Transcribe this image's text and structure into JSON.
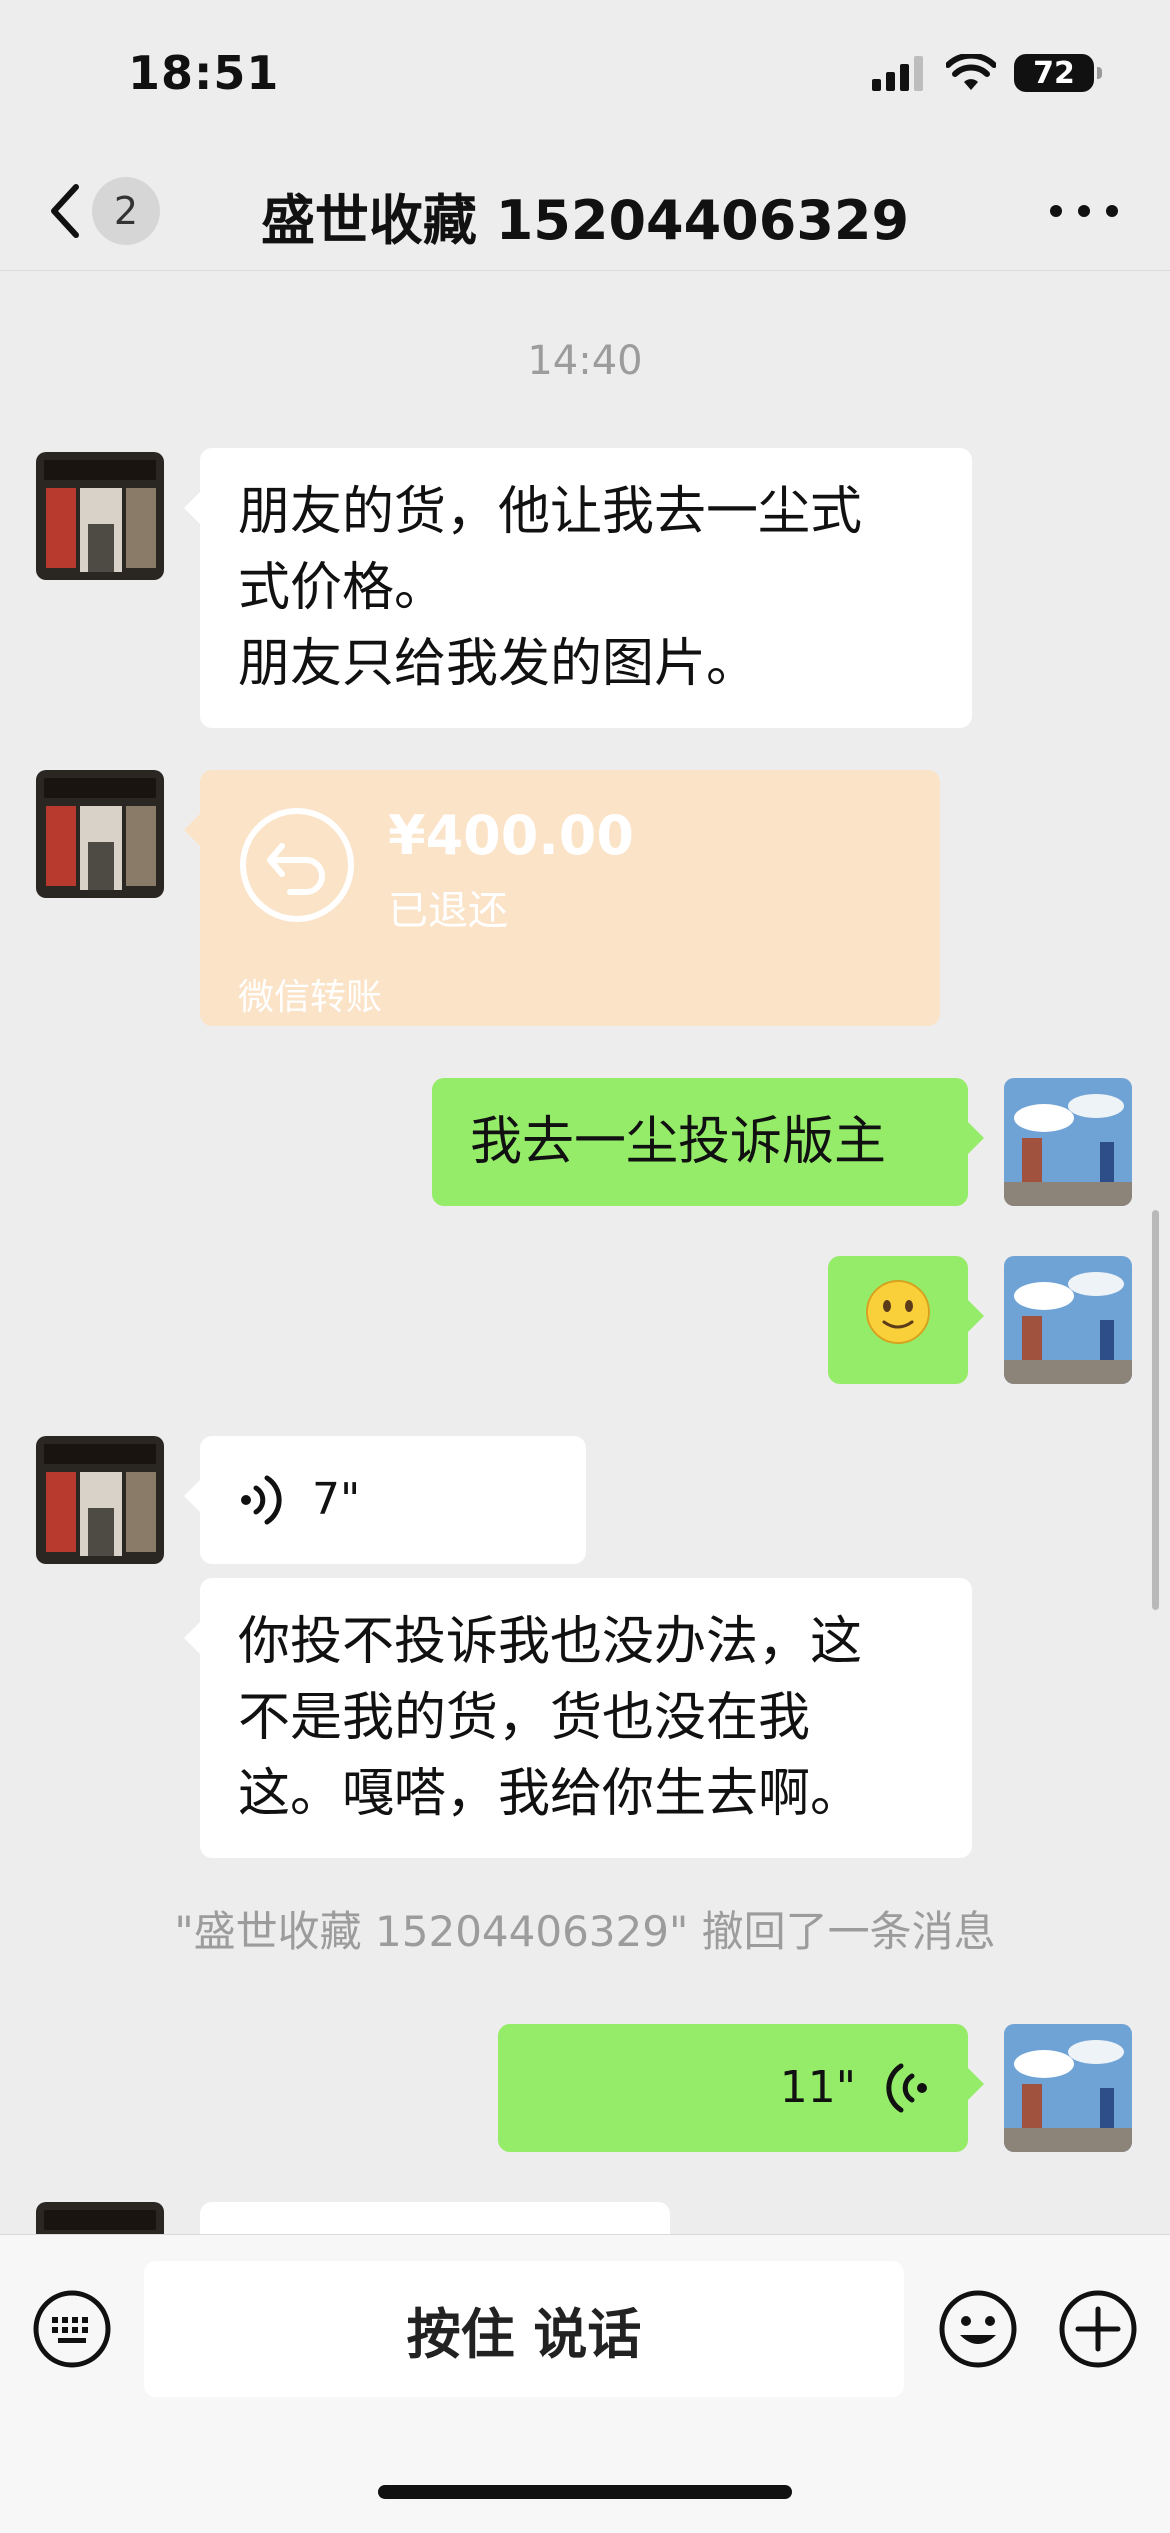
{
  "status_bar": {
    "time": "18:51",
    "battery": "72"
  },
  "header": {
    "unread_count": "2",
    "title": "盛世收藏 15204406329"
  },
  "chat": {
    "timestamp": "14:40",
    "msg1": {
      "lines": [
        "朋友的货，他让我去一尘式",
        "式价格。",
        "朋友只给我发的图片。"
      ]
    },
    "transfer": {
      "amount": "¥400.00",
      "status": "已退还",
      "footer": "微信转账"
    },
    "msg3": {
      "text": "我去一尘投诉版主"
    },
    "msg4": {
      "emoji": "🙂"
    },
    "voice_in": {
      "duration": "7\""
    },
    "msg6": {
      "lines": [
        "你投不投诉我也没办法，这",
        "不是我的货，货也没在我",
        "这。嘎嗒，我给你生去啊。"
      ]
    },
    "system": "\"盛世收藏 15204406329\" 撤回了一条消息",
    "voice_out": {
      "duration": "11\""
    }
  },
  "input_bar": {
    "hold_to_talk": "按住 说话"
  },
  "colors": {
    "bubble_out": "#95EC69",
    "bubble_in": "#FFFFFF",
    "transfer": "#FBE3C8",
    "background": "#EDEDED"
  },
  "icons": [
    "signal-icon",
    "wifi-icon",
    "battery-icon",
    "back-icon",
    "more-icon",
    "keyboard-icon",
    "emoji-icon",
    "plus-icon",
    "voice-wave-icon",
    "refund-arrow-icon"
  ]
}
